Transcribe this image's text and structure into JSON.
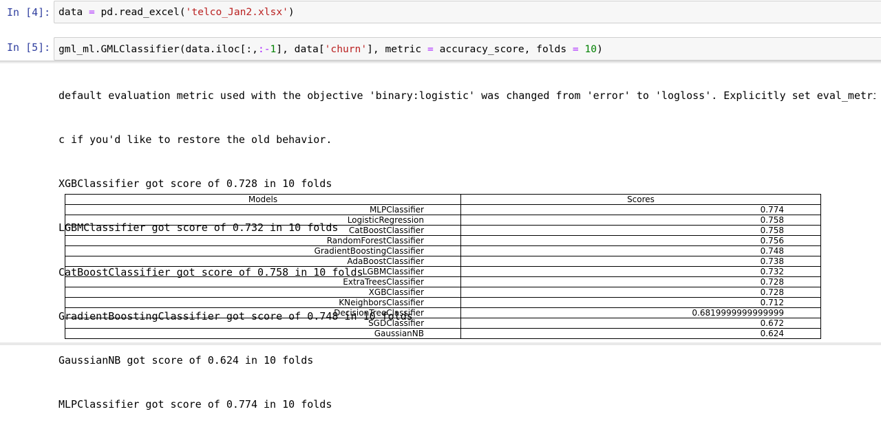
{
  "cells": [
    {
      "prompt": "In [4]:",
      "code": [
        {
          "t": "data ",
          "c": ""
        },
        {
          "t": "=",
          "c": "op"
        },
        {
          "t": " pd.read_excel(",
          "c": ""
        },
        {
          "t": "'telco_Jan2.xlsx'",
          "c": "str"
        },
        {
          "t": ")",
          "c": ""
        }
      ]
    },
    {
      "prompt": "In [5]:",
      "code": [
        {
          "t": "gml_ml.GMLClassifier(data.iloc[:,",
          "c": ""
        },
        {
          "t": ":-",
          "c": "op"
        },
        {
          "t": "1",
          "c": "num"
        },
        {
          "t": "], data[",
          "c": ""
        },
        {
          "t": "'churn'",
          "c": "str"
        },
        {
          "t": "], metric ",
          "c": ""
        },
        {
          "t": "=",
          "c": "op"
        },
        {
          "t": " accuracy_score, folds ",
          "c": ""
        },
        {
          "t": "=",
          "c": "op"
        },
        {
          "t": " ",
          "c": ""
        },
        {
          "t": "10",
          "c": "num"
        },
        {
          "t": ")",
          "c": ""
        }
      ]
    }
  ],
  "output": {
    "lines": [
      "default evaluation metric used with the objective 'binary:logistic' was changed from 'error' to 'logloss'. Explicitly set eval_metri",
      "c if you'd like to restore the old behavior.",
      "XGBClassifier got score of 0.728 in 10 folds",
      "LGBMClassifier got score of 0.732 in 10 folds",
      "CatBoostClassifier got score of 0.758 in 10 folds",
      "GradientBoostingClassifier got score of 0.748 in 10 folds",
      "GaussianNB got score of 0.624 in 10 folds",
      "MLPClassifier got score of 0.774 in 10 folds"
    ]
  },
  "table": {
    "headers": [
      "Models",
      "Scores"
    ],
    "rows": [
      [
        "MLPClassifier",
        "0.774"
      ],
      [
        "LogisticRegression",
        "0.758"
      ],
      [
        "CatBoostClassifier",
        "0.758"
      ],
      [
        "RandomForestClassifier",
        "0.756"
      ],
      [
        "GradientBoostingClassifier",
        "0.748"
      ],
      [
        "AdaBoostClassifier",
        "0.738"
      ],
      [
        "LGBMClassifier",
        "0.732"
      ],
      [
        "ExtraTreesClassifier",
        "0.728"
      ],
      [
        "XGBClassifier",
        "0.728"
      ],
      [
        "KNeighborsClassifier",
        "0.712"
      ],
      [
        "DecisionTreeClassifier",
        "0.6819999999999999"
      ],
      [
        "SGDClassifier",
        "0.672"
      ],
      [
        "GaussianNB",
        "0.624"
      ]
    ]
  },
  "colors": {
    "prompt": "#303f9f",
    "operator": "#aa22ff",
    "string": "#ba2121",
    "number": "#008000",
    "input_bg": "#f7f7f7"
  }
}
